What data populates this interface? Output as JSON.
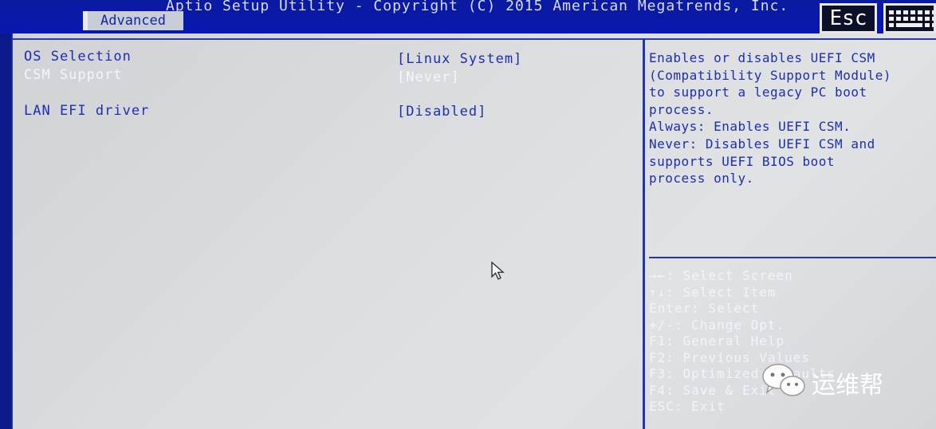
{
  "header": {
    "title": "Aptio Setup Utility - Copyright (C) 2015 American Megatrends, Inc.",
    "active_tab": "Advanced",
    "esc_label": "Esc",
    "keyboard_icon": "keyboard-icon"
  },
  "settings": [
    {
      "label": "OS Selection",
      "value": "[Linux System]",
      "selected": false
    },
    {
      "label": "CSM Support",
      "value": "[Never]",
      "selected": true
    },
    {
      "label": "LAN EFI driver",
      "value": "[Disabled]",
      "selected": false
    }
  ],
  "help": {
    "lines": [
      "Enables or disables UEFI CSM",
      "(Compatibility Support Module)",
      "to support a legacy PC boot",
      "process.",
      "Always: Enables UEFI CSM.",
      "Never: Disables UEFI CSM and",
      "supports UEFI BIOS boot",
      "process only."
    ]
  },
  "key_help": [
    "→←: Select Screen",
    "↑↓: Select Item",
    "Enter: Select",
    "+/-: Change Opt.",
    "F1: General Help",
    "F2: Previous Values",
    "F3: Optimized Defaults",
    "F4: Save & Exit",
    "ESC: Exit"
  ],
  "watermark": {
    "text": "运维帮",
    "icon": "wechat-icon"
  },
  "colors": {
    "bios_blue": "#0b1a8a",
    "text_blue": "#1d2fb0",
    "panel_gray": "#d8dadc",
    "highlight": "#f4f6ff"
  }
}
